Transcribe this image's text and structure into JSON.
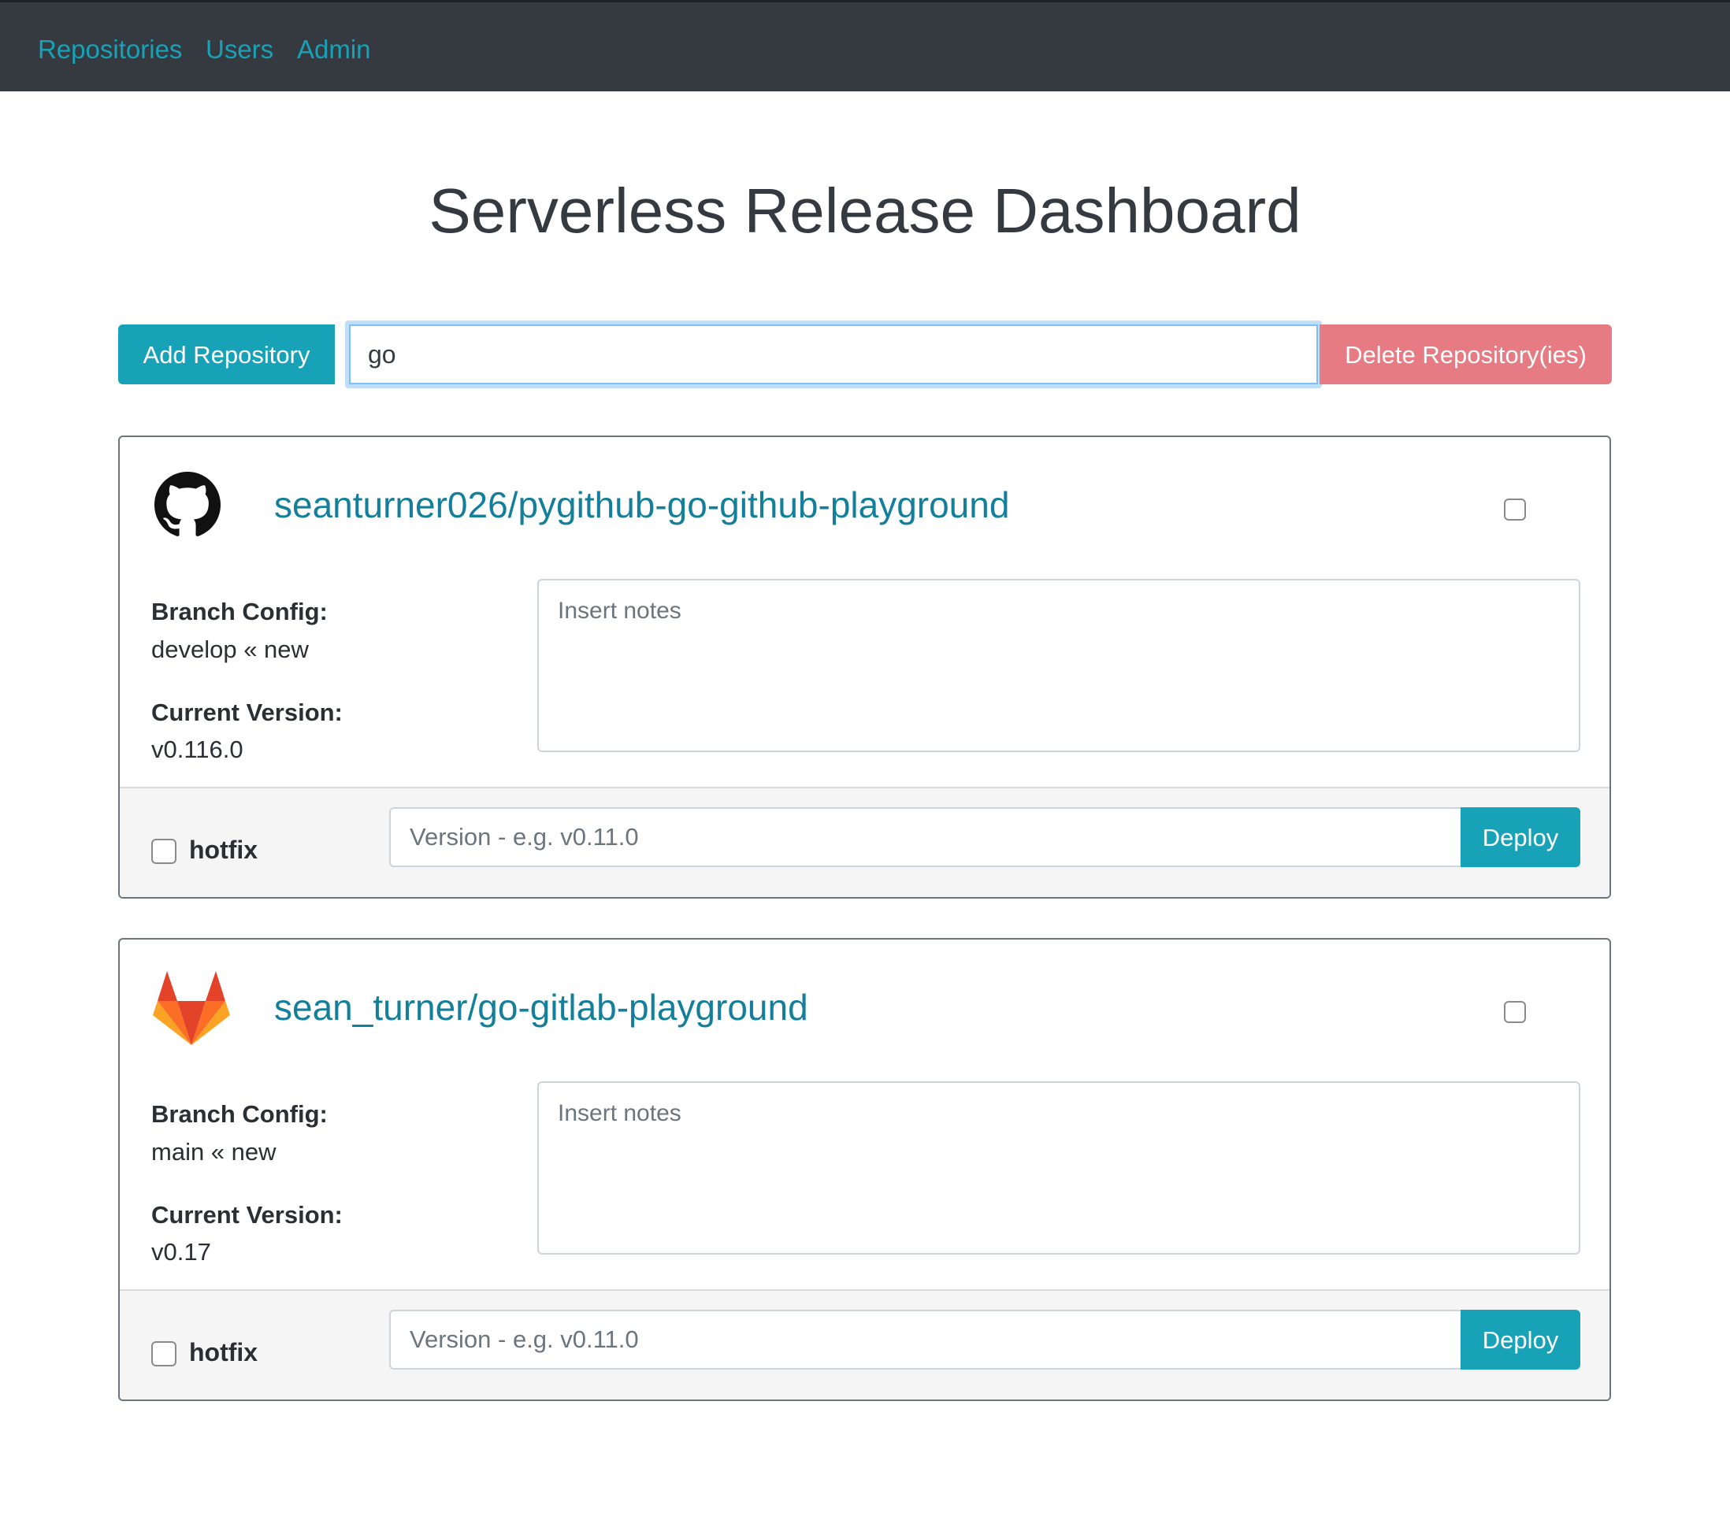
{
  "nav": {
    "items": [
      {
        "label": "Repositories"
      },
      {
        "label": "Users"
      },
      {
        "label": "Admin"
      }
    ]
  },
  "page": {
    "title": "Serverless Release Dashboard"
  },
  "toolbar": {
    "add_label": "Add Repository",
    "search_value": "go",
    "delete_label": "Delete Repository(ies)"
  },
  "repositories": [
    {
      "provider_icon": "github-icon",
      "name": "seanturner026/pygithub-go-github-playground",
      "selected": false,
      "branch_config_label": "Branch Config:",
      "branch_config": "develop « new",
      "current_version_label": "Current Version:",
      "current_version": "v0.116.0",
      "notes_placeholder": "Insert notes",
      "hotfix_label": "hotfix",
      "hotfix_checked": false,
      "version_placeholder": "Version - e.g. v0.11.0",
      "deploy_label": "Deploy"
    },
    {
      "provider_icon": "gitlab-icon",
      "name": "sean_turner/go-gitlab-playground",
      "selected": false,
      "branch_config_label": "Branch Config:",
      "branch_config": "main « new",
      "current_version_label": "Current Version:",
      "current_version": "v0.17",
      "notes_placeholder": "Insert notes",
      "hotfix_label": "hotfix",
      "hotfix_checked": false,
      "version_placeholder": "Version - e.g. v0.11.0",
      "deploy_label": "Deploy"
    }
  ],
  "colors": {
    "navbar": "#343a40",
    "accent": "#17a2b8",
    "link": "#137f9b",
    "danger": "#e77b84",
    "footer": "#f5f5f5"
  }
}
